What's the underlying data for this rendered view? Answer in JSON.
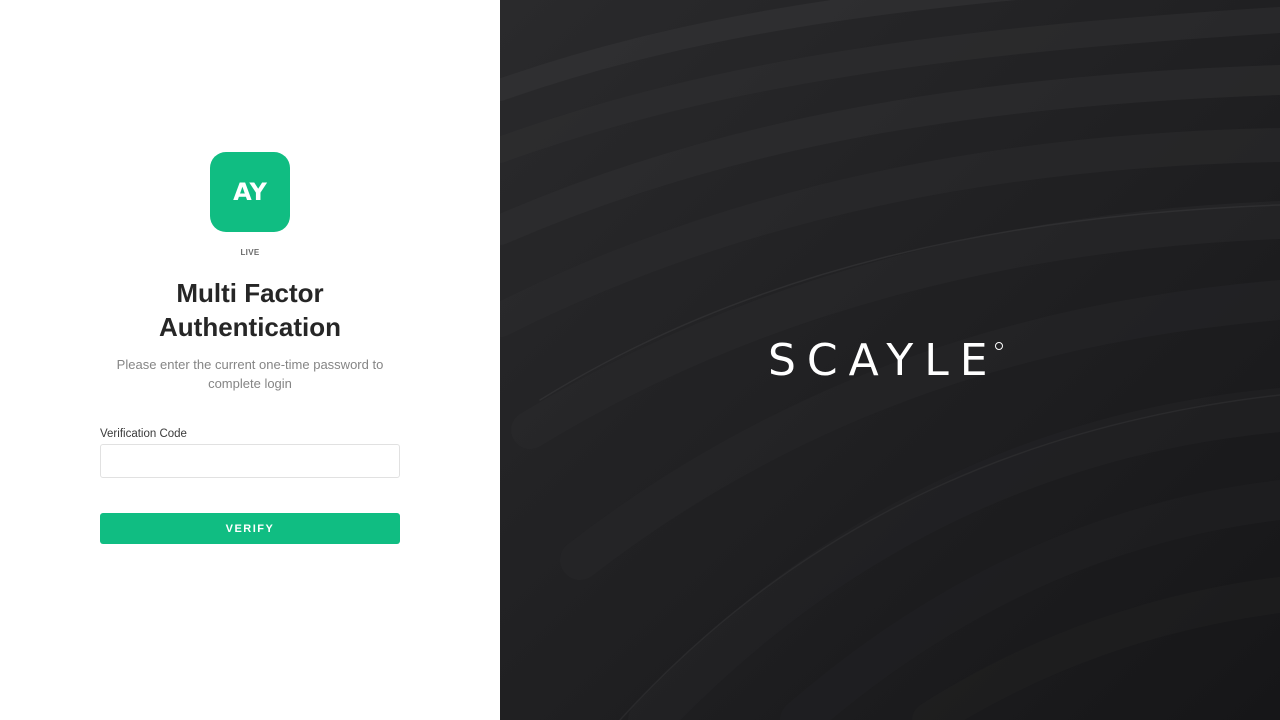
{
  "app": {
    "logo_text": "AY",
    "environment": "LIVE",
    "brand_color": "#10bd82"
  },
  "mfa": {
    "title_line1": "Multi Factor",
    "title_line2": "Authentication",
    "subtitle": "Please enter the current one-time password to complete login",
    "field_label": "Verification Code",
    "input_value": "",
    "verify_label": "VERIFY"
  },
  "brand": {
    "name": "SCAYLE",
    "background_color": "#1c1c1e"
  }
}
